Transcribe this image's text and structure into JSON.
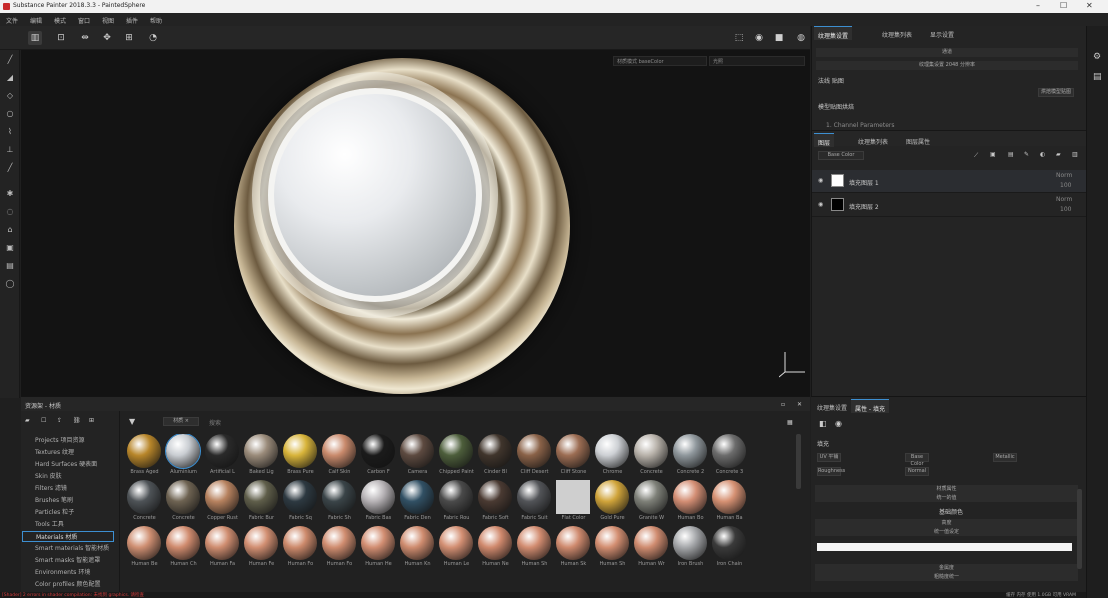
{
  "window": {
    "title": "Substance Painter 2018.3.3 - PaintedSphere",
    "controls": [
      "–",
      "☐",
      "✕"
    ]
  },
  "menu": [
    "文件",
    "编辑",
    "模式",
    "窗口",
    "视图",
    "插件",
    "帮助"
  ],
  "viewport": {
    "channel_label": "材质模式",
    "channel_value": "baseColor",
    "view_label": "光照"
  },
  "texture_set": {
    "tabs": [
      "纹理集设置",
      "纹理集列表",
      "显示设置"
    ],
    "rows": [
      "通道",
      "纹理集设置 2048 分辨率",
      "法线 贴图"
    ],
    "uv_button": "烘焙模型贴图",
    "bake_label": "模型贴图烘焙",
    "bake_item": "1. Channel Parameters"
  },
  "layers": {
    "tabs": [
      "图层",
      "纹理集列表",
      "图层属性"
    ],
    "blend_label": "Base Color",
    "items": [
      {
        "name": "填充图层 1",
        "blend": "Norm",
        "opacity": "100",
        "swatch": "#ffffff",
        "selected": true
      },
      {
        "name": "填充图层 2",
        "blend": "Norm",
        "opacity": "100",
        "swatch": "#000000",
        "selected": false
      }
    ]
  },
  "shelf": {
    "title": "资源架 - 材质",
    "search_tag": "材质 ×",
    "search_placeholder": "搜索",
    "categories": [
      "Projects 项目资源",
      "Textures 纹理",
      "Hard Surfaces 硬表面",
      "Skin 皮肤",
      "Filters 滤镜",
      "Brushes 笔刷",
      "Particles 粒子",
      "Tools 工具",
      "Materials 材质",
      "Smart materials 智能材质",
      "Smart masks 智能遮罩",
      "Environments 环境",
      "Color profiles 颜色配置"
    ],
    "selected_category": "Materials 材质",
    "materials": [
      {
        "name": "Brass Aged",
        "color": "#b8862a"
      },
      {
        "name": "Aluminium",
        "color": "#c9cdd2"
      },
      {
        "name": "Artificial L",
        "color": "#2a2a2a"
      },
      {
        "name": "Baked Lig",
        "color": "#9a8b7a"
      },
      {
        "name": "Brass Pure",
        "color": "#d8b43a"
      },
      {
        "name": "Calf Skin",
        "color": "#c98a6c"
      },
      {
        "name": "Carbon F",
        "color": "#1b1b1b"
      },
      {
        "name": "Camera",
        "color": "#5d4a40"
      },
      {
        "name": "Chipped Paint",
        "color": "#4d5e3b"
      },
      {
        "name": "Cinder Bl",
        "color": "#40352c"
      },
      {
        "name": "Cliff Desert",
        "color": "#8a6248"
      },
      {
        "name": "Cliff Stone",
        "color": "#9c6d53"
      },
      {
        "name": "Chrome",
        "color": "#cdd0d4"
      },
      {
        "name": "Concrete",
        "color": "#b8b2aa"
      },
      {
        "name": "Concrete 2",
        "color": "#8f979c"
      },
      {
        "name": "Concrete 3",
        "color": "#6c6c6c"
      },
      {
        "name": "Concrete",
        "color": "#4e5357"
      },
      {
        "name": "Concrete",
        "color": "#6e6352"
      },
      {
        "name": "Copper Rust",
        "color": "#b7825f"
      },
      {
        "name": "Fabric Bur",
        "color": "#5f5e4a"
      },
      {
        "name": "Fabric Sq",
        "color": "#2d3941"
      },
      {
        "name": "Fabric Sh",
        "color": "#3a4448"
      },
      {
        "name": "Fabric Bas",
        "color": "#b7b3b6"
      },
      {
        "name": "Fabric Den",
        "color": "#315064"
      },
      {
        "name": "Fabric Rou",
        "color": "#4a4a4a"
      },
      {
        "name": "Fabric Soft",
        "color": "#4a3a32"
      },
      {
        "name": "Fabric Suit",
        "color": "#525458"
      },
      {
        "name": "Flat Color",
        "color": "#cfcfcf"
      },
      {
        "name": "Gold Pure",
        "color": "#d0a43a"
      },
      {
        "name": "Granite W",
        "color": "#7e8078"
      },
      {
        "name": "Human Bo",
        "color": "#d38e74"
      },
      {
        "name": "Human Ba",
        "color": "#d69173"
      },
      {
        "name": "Human Be",
        "color": "#cf8f72"
      },
      {
        "name": "Human Ch",
        "color": "#d08b6e"
      },
      {
        "name": "Human Fa",
        "color": "#cf8d70"
      },
      {
        "name": "Human Fe",
        "color": "#d28f72"
      },
      {
        "name": "Human Fo",
        "color": "#cd8a6c"
      },
      {
        "name": "Human Fo",
        "color": "#d08d70"
      },
      {
        "name": "Human He",
        "color": "#d28e72"
      },
      {
        "name": "Human Kn",
        "color": "#cf8c6f"
      },
      {
        "name": "Human Le",
        "color": "#d38f73"
      },
      {
        "name": "Human Ne",
        "color": "#d0896d"
      },
      {
        "name": "Human Sh",
        "color": "#d28c70"
      },
      {
        "name": "Human Sk",
        "color": "#cf8a6e"
      },
      {
        "name": "Human Sh",
        "color": "#d38e71"
      },
      {
        "name": "Human Wr",
        "color": "#d08c70"
      },
      {
        "name": "Iron Brush",
        "color": "#a6a8ab"
      },
      {
        "name": "Iron Chain",
        "color": "#3a3a3a"
      }
    ]
  },
  "properties": {
    "tabs": [
      "纹理集设置",
      "属性 - 填充"
    ],
    "section": "填充",
    "buttons": [
      "UV 平铺",
      "Base Color",
      "Metallic",
      "Roughness",
      "Normal"
    ],
    "groups": [
      "材质属性",
      "基础颜色",
      "高度",
      "金属度"
    ],
    "sub_labels": [
      "统一的值",
      "统一值设定",
      "粗糙度统一"
    ]
  },
  "status": {
    "error": "[Shader] 2 errors in shader compilation: 未找到 graphics. 请检查",
    "right": "缓存 内存 使用 1.0GB  可用 VRAM"
  }
}
